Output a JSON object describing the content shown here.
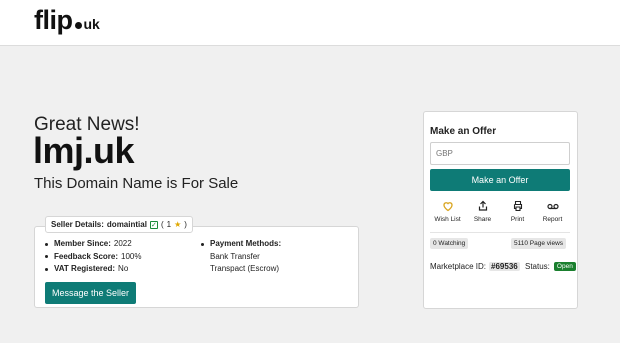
{
  "header": {
    "logo_main": "flip",
    "logo_tld": "uk"
  },
  "hero": {
    "line1": "Great News!",
    "domain": "lmj.uk",
    "line3": "This Domain Name is For Sale"
  },
  "seller": {
    "tag_label": "Seller Details:",
    "tag_username": "domaintial",
    "tag_open": "(",
    "tag_rating": "1",
    "tag_close": ")",
    "member_since_label": "Member Since:",
    "member_since_value": "2022",
    "feedback_label": "Feedback Score:",
    "feedback_value": "100%",
    "vat_label": "VAT Registered:",
    "vat_value": "No",
    "payment_label": "Payment Methods:",
    "payment_methods": [
      "Bank Transfer",
      "Transpact (Escrow)"
    ],
    "message_button": "Message the Seller"
  },
  "offer": {
    "title": "Make an Offer",
    "currency_placeholder": "GBP",
    "button": "Make an Offer",
    "actions": [
      {
        "label": "Wish List",
        "icon": "heart-icon"
      },
      {
        "label": "Share",
        "icon": "share-icon"
      },
      {
        "label": "Print",
        "icon": "print-icon"
      },
      {
        "label": "Report",
        "icon": "report-icon"
      }
    ],
    "watching": "0 Watching",
    "page_views": "5110 Page views",
    "marketplace_label": "Marketplace ID:",
    "marketplace_id": "#69536",
    "status_label": "Status:",
    "status_value": "Open",
    "colors": {
      "accent": "#0e7b76",
      "status_open": "#1a7f2e",
      "heart": "#d9a520"
    }
  }
}
